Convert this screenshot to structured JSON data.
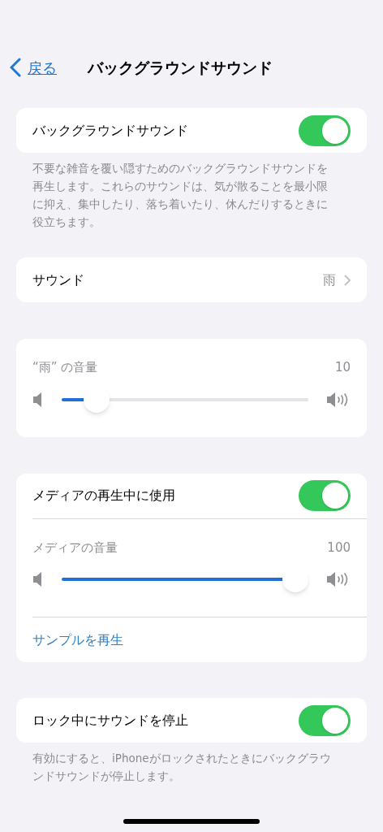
{
  "nav": {
    "back": "戻る",
    "title": "バックグラウンドサウンド"
  },
  "sections": [
    {
      "rows": [
        {
          "kind": "toggle",
          "label": "バックグラウンドサウンド",
          "on": true
        }
      ],
      "footer": "不要な雑音を覆い隠すためのバックグラウンドサウンドを再生します。これらのサウンドは、気が散ることを最小限に抑え、集中したり、落ち着いたり、休んだりするときに役立ちます。"
    },
    {
      "rows": [
        {
          "kind": "link",
          "label": "サウンド",
          "value": "雨"
        }
      ]
    },
    {
      "rows": [
        {
          "kind": "slider",
          "label": "“雨” の音量",
          "reading": "10",
          "level": 0.1
        }
      ]
    },
    {
      "rows": [
        {
          "kind": "toggle",
          "label": "メディアの再生中に使用",
          "on": true
        },
        {
          "kind": "slider",
          "label": "メディアの音量",
          "reading": "100",
          "level": 1
        },
        {
          "kind": "action",
          "label": "サンプルを再生"
        }
      ]
    },
    {
      "rows": [
        {
          "kind": "toggle",
          "label": "ロック中にサウンドを停止",
          "on": true
        }
      ],
      "footer": "有効にすると、iPhoneがロックされたときにバックグラウンドサウンドが停止します。"
    }
  ]
}
